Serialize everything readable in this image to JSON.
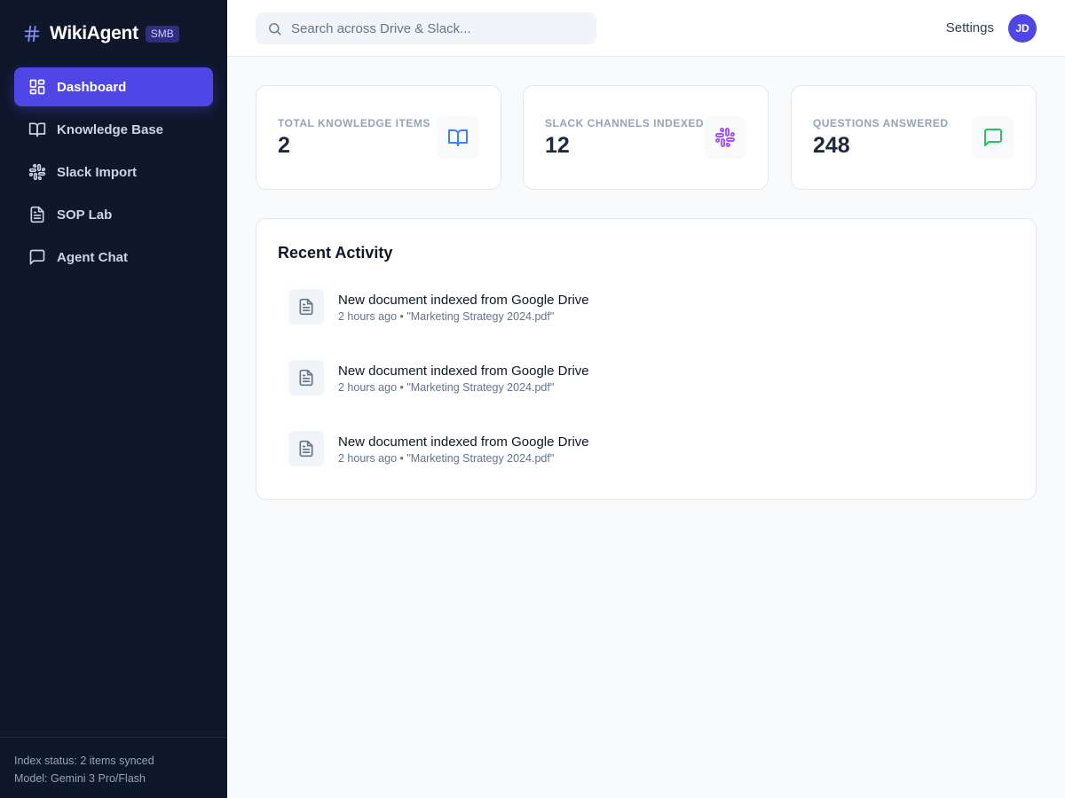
{
  "brand": {
    "name": "WikiAgent",
    "badge": "SMB",
    "icon": "hash-icon",
    "accent": "#4f46e5"
  },
  "sidebar": {
    "items": [
      {
        "label": "Dashboard",
        "icon": "dashboard-icon",
        "active": true
      },
      {
        "label": "Knowledge Base",
        "icon": "book-icon",
        "active": false
      },
      {
        "label": "Slack Import",
        "icon": "slack-icon",
        "active": false
      },
      {
        "label": "SOP Lab",
        "icon": "document-icon",
        "active": false
      },
      {
        "label": "Agent Chat",
        "icon": "chat-icon",
        "active": false
      }
    ],
    "footer": {
      "index_status": "Index status: 2 items synced",
      "model": "Model: Gemini 3 Pro/Flash"
    }
  },
  "header": {
    "search_placeholder": "Search across Drive & Slack...",
    "settings_label": "Settings",
    "avatar_initials": "JD"
  },
  "stats": [
    {
      "label": "Total Knowledge Items",
      "value": "2",
      "icon": "book-icon",
      "color": "#3b82f6"
    },
    {
      "label": "Slack Channels Indexed",
      "value": "12",
      "icon": "slack-icon",
      "color": "#a855f7"
    },
    {
      "label": "Questions Answered",
      "value": "248",
      "icon": "chat-icon",
      "color": "#22c55e"
    }
  ],
  "activity": {
    "title": "Recent Activity",
    "items": [
      {
        "text": "New document indexed from Google Drive",
        "meta": "2 hours ago • \"Marketing Strategy 2024.pdf\"",
        "icon": "document-icon"
      },
      {
        "text": "New document indexed from Google Drive",
        "meta": "2 hours ago • \"Marketing Strategy 2024.pdf\"",
        "icon": "document-icon"
      },
      {
        "text": "New document indexed from Google Drive",
        "meta": "2 hours ago • \"Marketing Strategy 2024.pdf\"",
        "icon": "document-icon"
      }
    ]
  }
}
